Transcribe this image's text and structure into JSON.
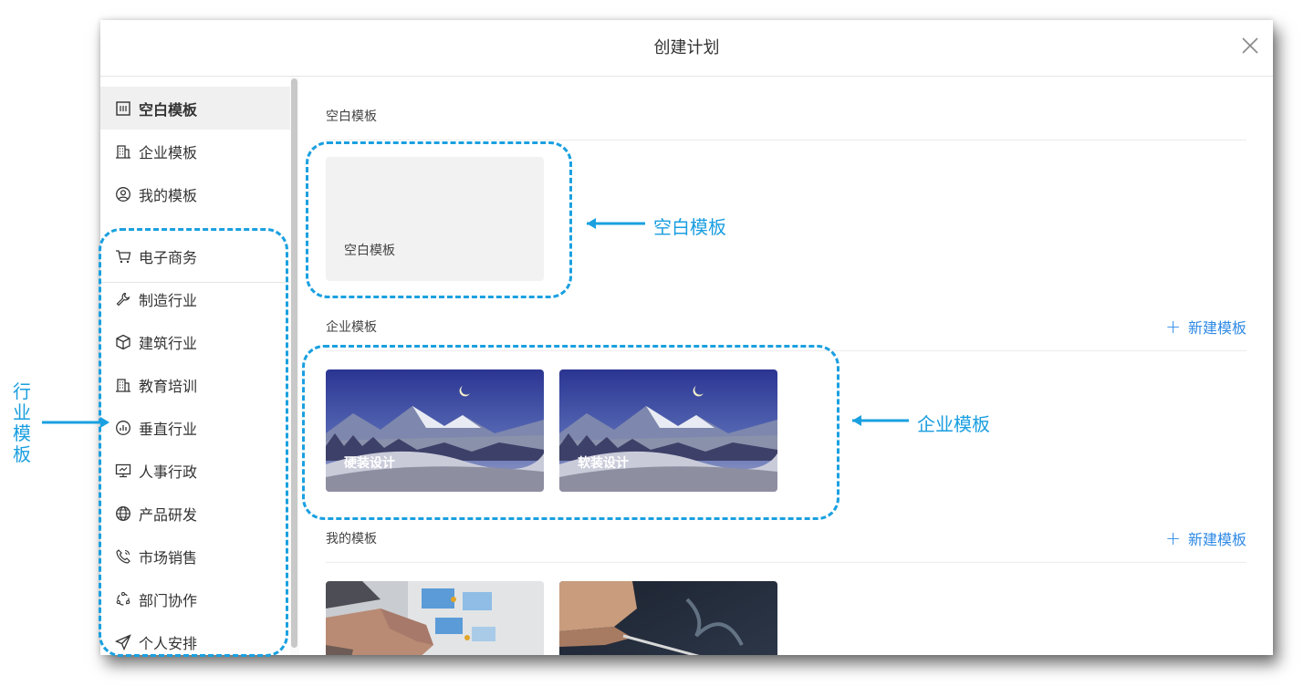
{
  "modal": {
    "title": "创建计划"
  },
  "sidebar": {
    "primary_items": [
      {
        "label": "空白模板",
        "icon": "blank-template-icon",
        "active": true
      },
      {
        "label": "企业模板",
        "icon": "building-icon",
        "active": false
      },
      {
        "label": "我的模板",
        "icon": "user-circle-icon",
        "active": false
      }
    ],
    "industry_items": [
      {
        "label": "电子商务",
        "icon": "cart-icon"
      },
      {
        "label": "制造行业",
        "icon": "wrench-icon"
      },
      {
        "label": "建筑行业",
        "icon": "cube-icon"
      },
      {
        "label": "教育培训",
        "icon": "building-icon"
      },
      {
        "label": "垂直行业",
        "icon": "chart-circle-icon"
      },
      {
        "label": "人事行政",
        "icon": "monitor-icon"
      },
      {
        "label": "产品研发",
        "icon": "globe-icon"
      },
      {
        "label": "市场销售",
        "icon": "phone-icon"
      },
      {
        "label": "部门协作",
        "icon": "collaboration-icon"
      },
      {
        "label": "个人安排",
        "icon": "send-icon"
      }
    ]
  },
  "sections": {
    "blank": {
      "title": "空白模板",
      "cards": [
        {
          "label": "空白模板"
        }
      ]
    },
    "enterprise": {
      "title": "企业模板",
      "new_label": "新建模板",
      "cards": [
        {
          "label": "硬装设计"
        },
        {
          "label": "软装设计"
        }
      ]
    },
    "mine": {
      "title": "我的模板",
      "new_label": "新建模板"
    }
  },
  "annotations": {
    "blank": "空白模板",
    "enterprise": "企业模板",
    "industry": "行业模板",
    "color": "#1aa0e0"
  },
  "colors": {
    "accent": "#2f8ae5",
    "annotation": "#1aa0e0",
    "active_bg": "#f0f0f0"
  }
}
